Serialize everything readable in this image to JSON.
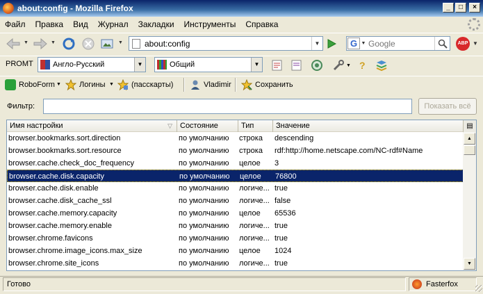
{
  "window": {
    "title": "about:config - Mozilla Firefox",
    "controls": [
      "_",
      "□",
      "×"
    ]
  },
  "menu": [
    "Файл",
    "Правка",
    "Вид",
    "Журнал",
    "Закладки",
    "Инструменты",
    "Справка"
  ],
  "nav": {
    "url": "about:config",
    "search_placeholder": "Google",
    "search_engine_letter": "G",
    "abp_label": "ABP"
  },
  "promt": {
    "label": "PROMT",
    "direction": "Англо-Русский",
    "topic": "Общий"
  },
  "roboform": {
    "roboform_label": "RoboForm",
    "logins_label": "Логины",
    "passcards_label": "(пасскарты)",
    "user_label": "Vladimir",
    "save_label": "Сохранить"
  },
  "filter": {
    "label": "Фильтр:",
    "value": "",
    "show_all_label": "Показать всё"
  },
  "table": {
    "columns": [
      "Имя настройки",
      "Состояние",
      "Тип",
      "Значение"
    ],
    "selected_index": 3,
    "rows": [
      [
        "browser.bookmarks.sort.direction",
        "по умолчанию",
        "строка",
        "descending"
      ],
      [
        "browser.bookmarks.sort.resource",
        "по умолчанию",
        "строка",
        "rdf:http://home.netscape.com/NC-rdf#Name"
      ],
      [
        "browser.cache.check_doc_frequency",
        "по умолчанию",
        "целое",
        "3"
      ],
      [
        "browser.cache.disk.capacity",
        "по умолчанию",
        "целое",
        "76800"
      ],
      [
        "browser.cache.disk.enable",
        "по умолчанию",
        "логиче...",
        "true"
      ],
      [
        "browser.cache.disk_cache_ssl",
        "по умолчанию",
        "логиче...",
        "false"
      ],
      [
        "browser.cache.memory.capacity",
        "по умолчанию",
        "целое",
        "65536"
      ],
      [
        "browser.cache.memory.enable",
        "по умолчанию",
        "логиче...",
        "true"
      ],
      [
        "browser.chrome.favicons",
        "по умолчанию",
        "логиче...",
        "true"
      ],
      [
        "browser.chrome.image_icons.max_size",
        "по умолчанию",
        "целое",
        "1024"
      ],
      [
        "browser.chrome.site_icons",
        "по умолчанию",
        "логиче...",
        "true"
      ]
    ]
  },
  "status": {
    "text": "Готово",
    "fasterfox_label": "Fasterfox"
  },
  "colors": {
    "selection": "#0a246a",
    "titlebar": "#0a246a",
    "chrome": "#ece9d8"
  }
}
